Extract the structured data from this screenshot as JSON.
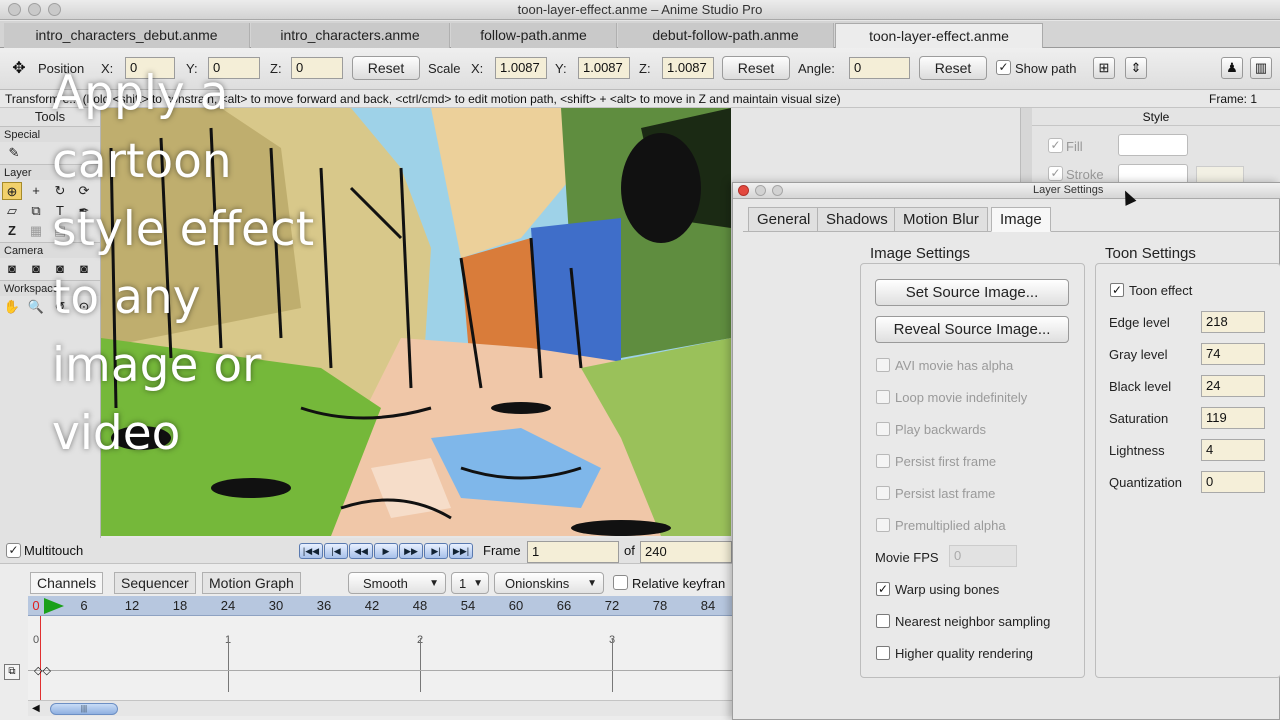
{
  "window": {
    "title": "toon-layer-effect.anme – Anime Studio Pro"
  },
  "tabs": [
    {
      "label": "intro_characters_debut.anme"
    },
    {
      "label": "intro_characters.anme"
    },
    {
      "label": "follow-path.anme"
    },
    {
      "label": "debut-follow-path.anme"
    },
    {
      "label": "toon-layer-effect.anme"
    }
  ],
  "toolbar": {
    "position_label": "Position",
    "x_label": "X:",
    "y_label": "Y:",
    "z_label": "Z:",
    "pos_x": "0",
    "pos_y": "0",
    "pos_z": "0",
    "reset": "Reset",
    "scale_label": "Scale",
    "scale_x": "1.0087",
    "scale_y": "1.0087",
    "scale_z": "1.0087",
    "angle_label": "Angle:",
    "angle": "0",
    "show_path": "Show path"
  },
  "status": {
    "hint": "Transform e... (hold <shift> to constrain, <alt> to move forward and back, <ctrl/cmd> to edit motion path, <shift> + <alt> to move in Z and maintain visual size)",
    "frame": "Frame: 1"
  },
  "tools_panel": {
    "title": "Tools",
    "special": "Special",
    "layer": "Layer",
    "camera": "Camera",
    "workspace": "Workspace"
  },
  "overlay_caption": [
    "Apply a",
    "cartoon",
    "style effect",
    "to any",
    "image or",
    "video"
  ],
  "style_panel": {
    "title": "Style",
    "fill": "Fill",
    "stroke": "Stroke"
  },
  "timeline": {
    "multitouch": "Multitouch",
    "frame_label": "Frame",
    "frame_value": "1",
    "of_label": "of",
    "total_frames": "240",
    "tabs": [
      "Channels",
      "Sequencer",
      "Motion Graph"
    ],
    "smooth": "Smooth",
    "step": "1",
    "onionskins": "Onionskins",
    "relative": "Relative keyfran",
    "ruler": [
      "0",
      "6",
      "12",
      "18",
      "24",
      "30",
      "36",
      "42",
      "48",
      "54",
      "60",
      "66",
      "72",
      "78",
      "84"
    ],
    "seconds": [
      "0",
      "1",
      "2",
      "3"
    ]
  },
  "dialog": {
    "title": "Layer Settings",
    "tabs": [
      "General",
      "Shadows",
      "Motion Blur",
      "Image"
    ],
    "image_settings": {
      "title": "Image Settings",
      "set_source": "Set Source Image...",
      "reveal_source": "Reveal Source Image...",
      "options": [
        {
          "label": "AVI movie has alpha",
          "checked": false,
          "enabled": false
        },
        {
          "label": "Loop movie indefinitely",
          "checked": false,
          "enabled": false
        },
        {
          "label": "Play backwards",
          "checked": false,
          "enabled": false
        },
        {
          "label": "Persist first frame",
          "checked": false,
          "enabled": false
        },
        {
          "label": "Persist last frame",
          "checked": false,
          "enabled": false
        },
        {
          "label": "Premultiplied alpha",
          "checked": false,
          "enabled": false
        }
      ],
      "fps_label": "Movie FPS",
      "fps_value": "0",
      "options2": [
        {
          "label": "Warp using bones",
          "checked": true,
          "enabled": true
        },
        {
          "label": "Nearest neighbor sampling",
          "checked": false,
          "enabled": true
        },
        {
          "label": "Higher quality rendering",
          "checked": false,
          "enabled": true
        }
      ]
    },
    "toon_settings": {
      "title": "Toon Settings",
      "toon_effect": "Toon effect",
      "fields": [
        {
          "label": "Edge level",
          "value": "218"
        },
        {
          "label": "Gray level",
          "value": "74"
        },
        {
          "label": "Black level",
          "value": "24"
        },
        {
          "label": "Saturation",
          "value": "119"
        },
        {
          "label": "Lightness",
          "value": "4"
        },
        {
          "label": "Quantization",
          "value": "0"
        }
      ]
    }
  }
}
